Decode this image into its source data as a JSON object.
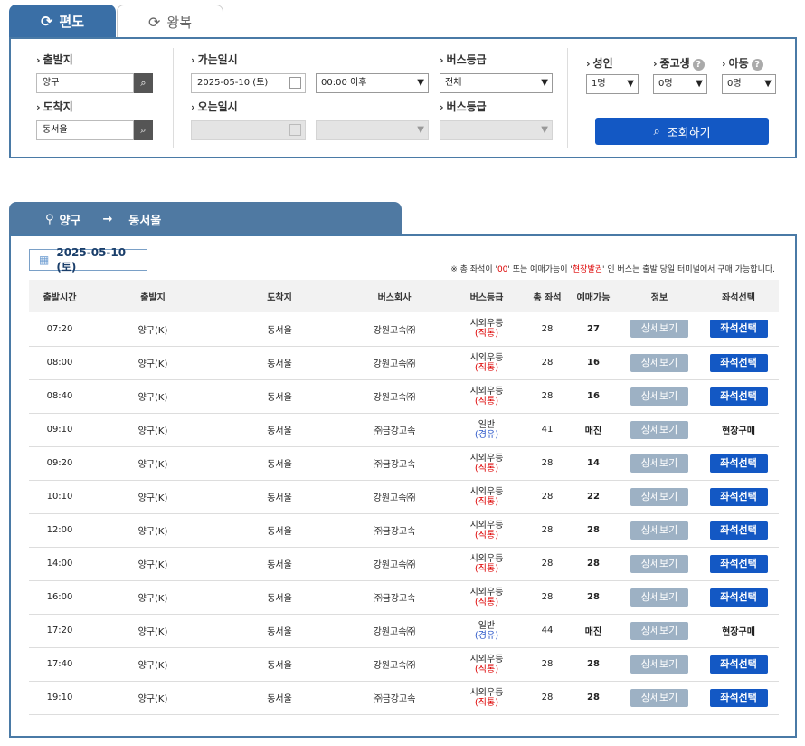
{
  "tabs": {
    "oneway": "편도",
    "roundtrip": "왕복"
  },
  "search": {
    "dep_label": "출발지",
    "dep_value": "양구",
    "arr_label": "도착지",
    "arr_value": "동서울",
    "go_date_label": "가는일시",
    "go_date_value": "2025-05-10 (토)",
    "go_time_value": "00:00 이후",
    "return_date_label": "오는일시",
    "grade_label": "버스등급",
    "grade_value": "전체",
    "grade_label2": "버스등급",
    "adult_label": "성인",
    "adult_value": "1명",
    "youth_label": "중고생",
    "youth_value": "0명",
    "child_label": "아동",
    "child_value": "0명",
    "submit_label": "조회하기"
  },
  "route": {
    "from": "양구",
    "to": "동서울"
  },
  "results": {
    "date": "2025-05-10 (토)",
    "notice_prefix": "※ 총 좌석이 '",
    "notice_zero": "00",
    "notice_mid": "' 또는 예매가능이 '",
    "notice_onsite": "현장발권",
    "notice_suffix": "' 인 버스는 출발 당일 터미널에서 구매 가능합니다.",
    "headers": [
      "출발시간",
      "출발지",
      "도착지",
      "버스회사",
      "버스등급",
      "총 좌석",
      "예매가능",
      "정보",
      "좌석선택"
    ],
    "detail_label": "상세보기",
    "seat_label": "좌석선택",
    "onsite_label": "현장구매",
    "rows": [
      {
        "time": "07:20",
        "dep": "양구(K)",
        "arr": "동서울",
        "company": "강원고속㈜",
        "grade": "시외우등",
        "sub": "(직통)",
        "seats": "28",
        "avail": "27",
        "onsite": false
      },
      {
        "time": "08:00",
        "dep": "양구(K)",
        "arr": "동서울",
        "company": "강원고속㈜",
        "grade": "시외우등",
        "sub": "(직통)",
        "seats": "28",
        "avail": "16",
        "onsite": false
      },
      {
        "time": "08:40",
        "dep": "양구(K)",
        "arr": "동서울",
        "company": "강원고속㈜",
        "grade": "시외우등",
        "sub": "(직통)",
        "seats": "28",
        "avail": "16",
        "onsite": false
      },
      {
        "time": "09:10",
        "dep": "양구(K)",
        "arr": "동서울",
        "company": "㈜금강고속",
        "grade": "일반",
        "sub": "(경유)",
        "seats": "41",
        "avail": "매진",
        "onsite": true
      },
      {
        "time": "09:20",
        "dep": "양구(K)",
        "arr": "동서울",
        "company": "㈜금강고속",
        "grade": "시외우등",
        "sub": "(직통)",
        "seats": "28",
        "avail": "14",
        "onsite": false
      },
      {
        "time": "10:10",
        "dep": "양구(K)",
        "arr": "동서울",
        "company": "강원고속㈜",
        "grade": "시외우등",
        "sub": "(직통)",
        "seats": "28",
        "avail": "22",
        "onsite": false
      },
      {
        "time": "12:00",
        "dep": "양구(K)",
        "arr": "동서울",
        "company": "㈜금강고속",
        "grade": "시외우등",
        "sub": "(직통)",
        "seats": "28",
        "avail": "28",
        "onsite": false
      },
      {
        "time": "14:00",
        "dep": "양구(K)",
        "arr": "동서울",
        "company": "강원고속㈜",
        "grade": "시외우등",
        "sub": "(직통)",
        "seats": "28",
        "avail": "28",
        "onsite": false
      },
      {
        "time": "16:00",
        "dep": "양구(K)",
        "arr": "동서울",
        "company": "㈜금강고속",
        "grade": "시외우등",
        "sub": "(직통)",
        "seats": "28",
        "avail": "28",
        "onsite": false
      },
      {
        "time": "17:20",
        "dep": "양구(K)",
        "arr": "동서울",
        "company": "강원고속㈜",
        "grade": "일반",
        "sub": "(경유)",
        "seats": "44",
        "avail": "매진",
        "onsite": true
      },
      {
        "time": "17:40",
        "dep": "양구(K)",
        "arr": "동서울",
        "company": "강원고속㈜",
        "grade": "시외우등",
        "sub": "(직통)",
        "seats": "28",
        "avail": "28",
        "onsite": false
      },
      {
        "time": "19:10",
        "dep": "양구(K)",
        "arr": "동서울",
        "company": "㈜금강고속",
        "grade": "시외우등",
        "sub": "(직통)",
        "seats": "28",
        "avail": "28",
        "onsite": false
      }
    ]
  }
}
